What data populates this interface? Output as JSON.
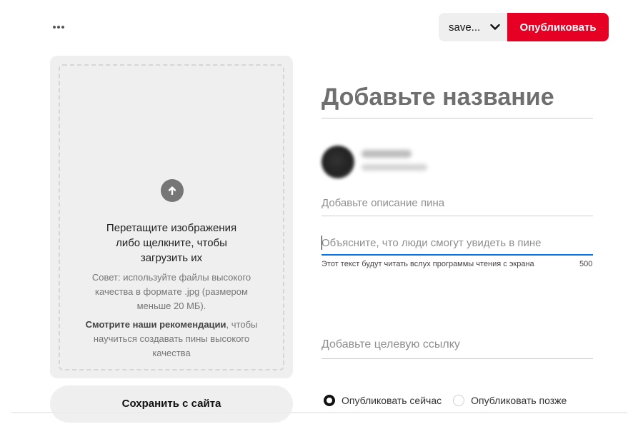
{
  "toolbar": {
    "more_icon": "ellipsis-icon",
    "board_select": {
      "selected": "save...",
      "icon": "chevron-down-icon"
    },
    "publish_label": "Опубликовать",
    "publish_color": "#e60023"
  },
  "upload": {
    "icon": "arrow-up-circle-icon",
    "main_lines": [
      "Перетащите изображения",
      "либо щелкните, чтобы",
      "загрузить их"
    ],
    "tip_lines": [
      "Совет: используйте файлы высокого",
      "качества в формате .jpg (размером",
      "меньше 20 МБ)."
    ],
    "reco_bold": "Смотрите наши рекомендации",
    "reco_rest_1": ", чтобы",
    "reco_lines": [
      "научиться создавать пины высокого",
      "качества"
    ],
    "save_from_site_label": "Сохранить с сайта"
  },
  "form": {
    "title_placeholder": "Добавьте название",
    "description_placeholder": "Добавьте описание пина",
    "alt_placeholder": "Объясните, что люди смогут увидеть в пине",
    "alt_hint": "Этот текст будут читать вслух программы чтения с экрана",
    "alt_count": "500",
    "link_placeholder": "Добавьте целевую ссылку",
    "focus_color": "#0074e8"
  },
  "publish_options": {
    "now_label": "Опубликовать сейчас",
    "later_label": "Опубликовать позже",
    "selected": "now"
  }
}
